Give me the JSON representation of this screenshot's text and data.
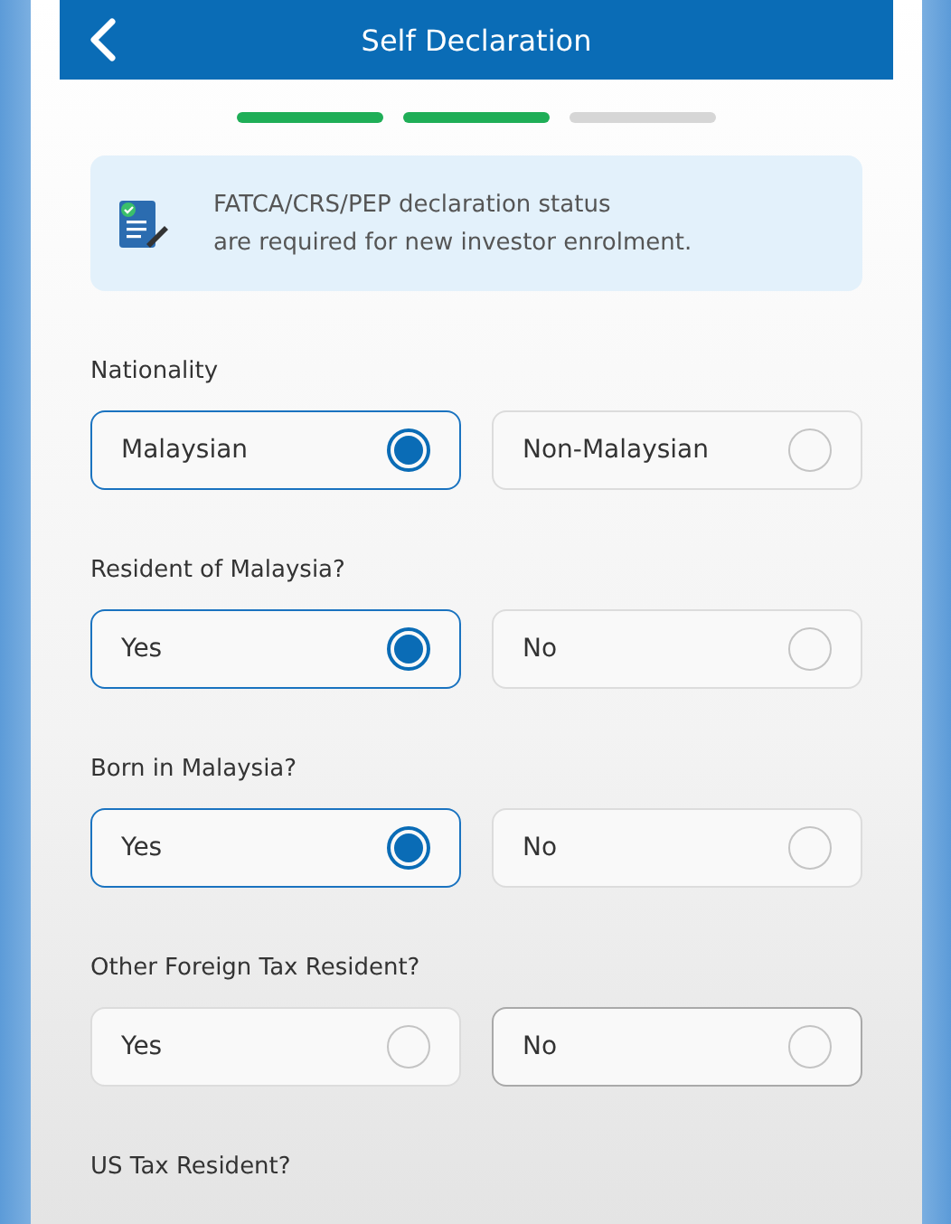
{
  "header": {
    "title": "Self Declaration"
  },
  "progress_steps": [
    {
      "done": true
    },
    {
      "done": true
    },
    {
      "done": false
    }
  ],
  "notice": {
    "text": "FATCA/CRS/PEP declaration status\nare required for new investor enrolment."
  },
  "questions": [
    {
      "label": "Nationality",
      "options": [
        {
          "label": "Malaysian",
          "selected": true,
          "focused": false
        },
        {
          "label": "Non-Malaysian",
          "selected": false,
          "focused": false
        }
      ]
    },
    {
      "label": "Resident of Malaysia?",
      "options": [
        {
          "label": "Yes",
          "selected": true,
          "focused": false
        },
        {
          "label": "No",
          "selected": false,
          "focused": false
        }
      ]
    },
    {
      "label": "Born in Malaysia?",
      "options": [
        {
          "label": "Yes",
          "selected": true,
          "focused": false
        },
        {
          "label": "No",
          "selected": false,
          "focused": false
        }
      ]
    },
    {
      "label": "Other Foreign Tax Resident?",
      "options": [
        {
          "label": "Yes",
          "selected": false,
          "focused": false
        },
        {
          "label": "No",
          "selected": false,
          "focused": true
        }
      ]
    },
    {
      "label": "US Tax Resident?"
    }
  ]
}
